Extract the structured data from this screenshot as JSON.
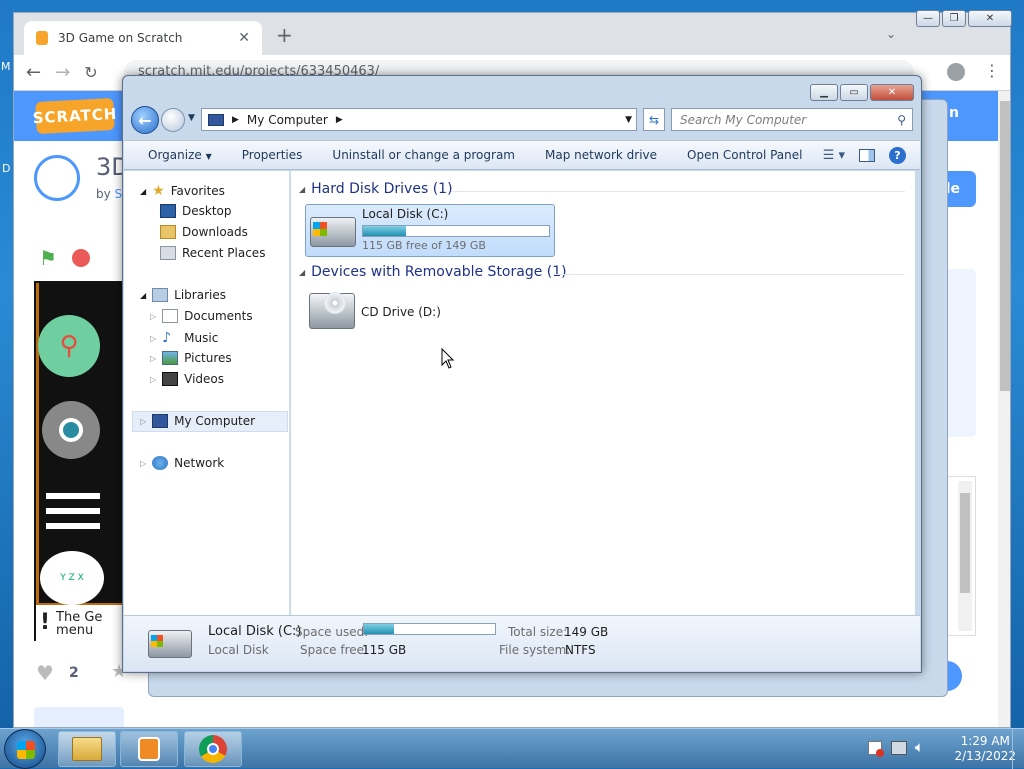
{
  "chrome": {
    "tab_title": "3D Game on Scratch",
    "new_tab": "+",
    "url": "scratch.mit.edu/projects/633450463/"
  },
  "scratch": {
    "logo": "SCRATCH",
    "project_title_partial": "3D",
    "by_label": "by",
    "by_user_partial": "S",
    "sign_in_partial": "n",
    "remix_partial": "de",
    "menu_text_1": "The Ge",
    "menu_text_2": "menu",
    "love_count": "2",
    "left_edge_1": "M",
    "left_edge_2": "D"
  },
  "explorer": {
    "breadcrumb": "My Computer",
    "search_placeholder": "Search My Computer",
    "commands": [
      "Organize",
      "Properties",
      "Uninstall or change a program",
      "Map network drive",
      "Open Control Panel"
    ],
    "nav": {
      "favorites": "Favorites",
      "favorites_items": [
        "Desktop",
        "Downloads",
        "Recent Places"
      ],
      "libraries": "Libraries",
      "libraries_items": [
        "Documents",
        "Music",
        "Pictures",
        "Videos"
      ],
      "computer": "My Computer",
      "network": "Network"
    },
    "groups": {
      "hdd": "Hard Disk Drives (1)",
      "removable": "Devices with Removable Storage (1)"
    },
    "local_disk": {
      "name": "Local Disk (C:)",
      "free_text": "115 GB free of 149 GB",
      "used_fraction": 0.23
    },
    "cd_drive": "CD Drive (D:)",
    "details": {
      "name": "Local Disk (C:)",
      "type": "Local Disk",
      "space_used_label": "Space used:",
      "space_free_label": "Space free:",
      "space_free_value": "115 GB",
      "total_size_label": "Total size:",
      "total_size_value": "149 GB",
      "fs_label": "File system:",
      "fs_value": "NTFS"
    }
  },
  "taskbar": {
    "time": "1:29 AM",
    "date": "2/13/2022"
  },
  "colors": {
    "scratch_blue": "#4d97ff",
    "scratch_orange": "#f7a52a",
    "explorer_frame": "#c9d9ec",
    "group_header": "#1e3287",
    "disk_bar": "#2390b2"
  }
}
